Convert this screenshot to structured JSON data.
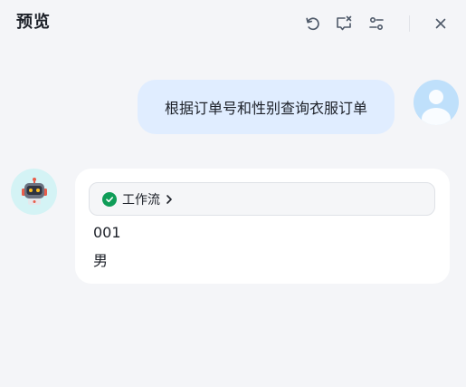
{
  "header": {
    "title": "预览",
    "icons": [
      "refresh-icon",
      "clear-chat-icon",
      "settings-sliders-icon",
      "close-icon"
    ]
  },
  "conversation": {
    "user_message": "根据订单号和性别查询衣服订单",
    "bot_reply": {
      "workflow_label": "工作流",
      "workflow_status": "success",
      "output_lines": [
        "001",
        "男"
      ]
    }
  },
  "colors": {
    "background": "#f4f5f8",
    "user_bubble": "#e0edff",
    "success": "#0f9d58"
  }
}
